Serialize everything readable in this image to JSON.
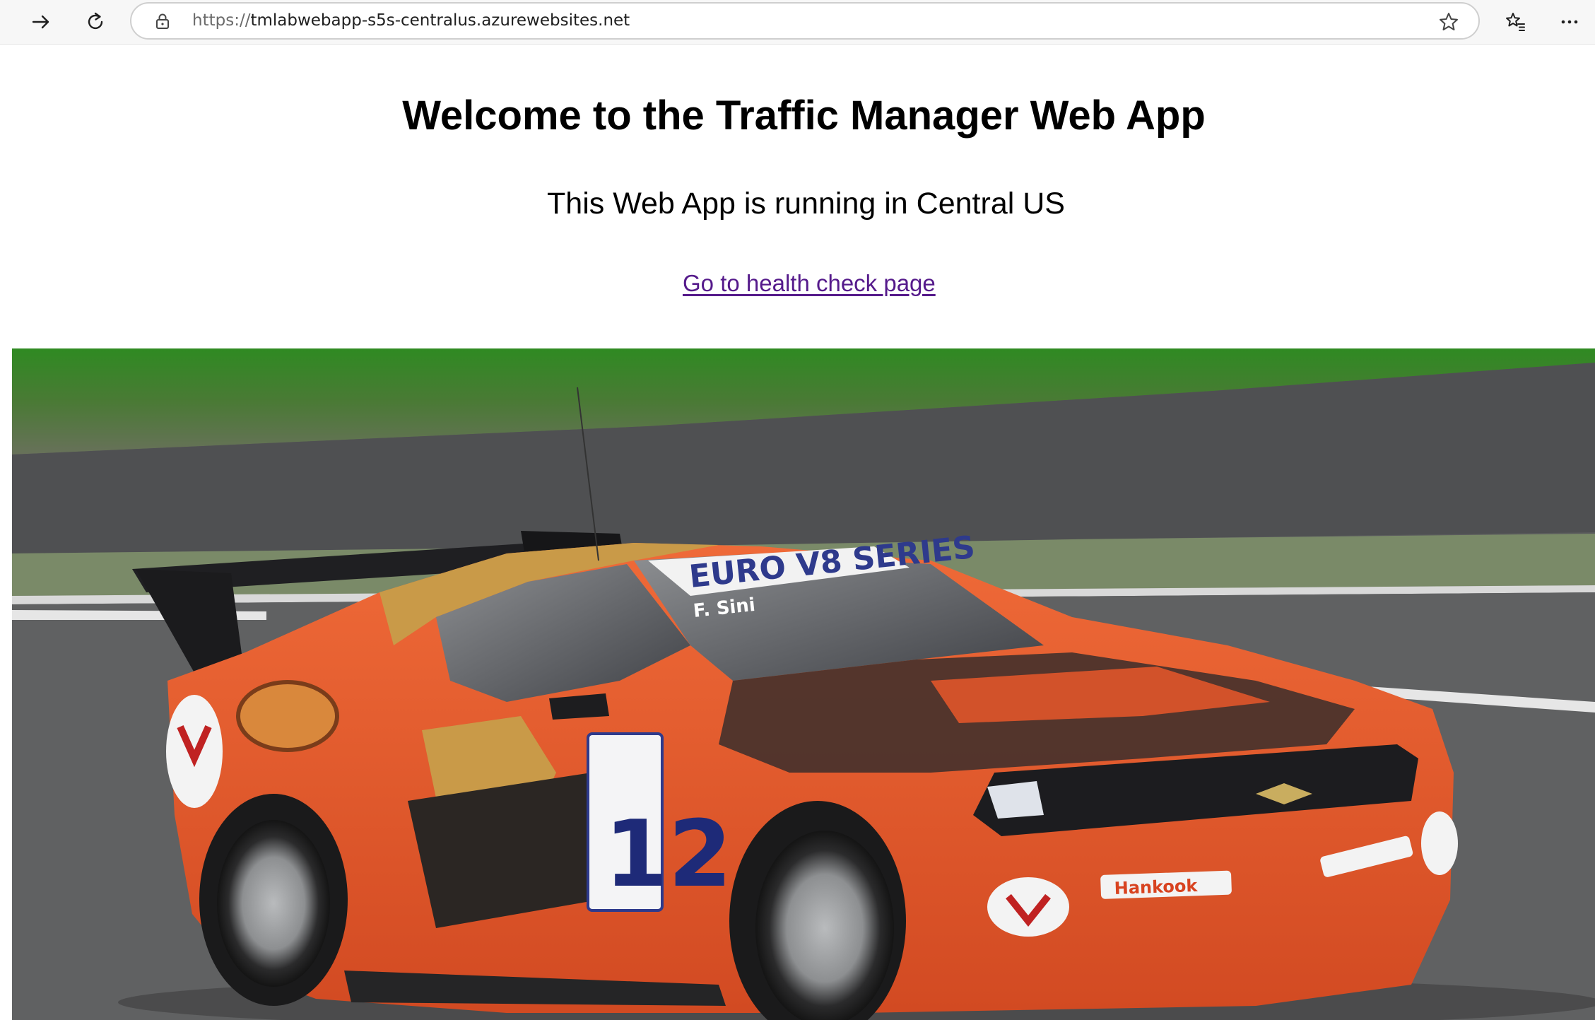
{
  "browser": {
    "url_scheme": "https://",
    "url_host": "tmlabwebapp-s5s-centralus.azurewebsites.net",
    "icons": [
      "forward-arrow-icon",
      "refresh-icon",
      "lock-icon",
      "star-icon",
      "favorites-icon",
      "more-icon"
    ]
  },
  "page": {
    "heading": "Welcome to the Traffic Manager Web App",
    "subheading": "This Web App is running in Central US",
    "health_link": "Go to health check page",
    "link_color": "#551a8b"
  },
  "photo": {
    "car_number": "12",
    "windshield_banner": "EURO V8 SERIES",
    "driver_name": "F. Sini",
    "hood_sponsor": "Hankook",
    "colors": {
      "body": "#e0552a",
      "grass": "#3d8a2c",
      "track": "#5e5f5f"
    }
  }
}
